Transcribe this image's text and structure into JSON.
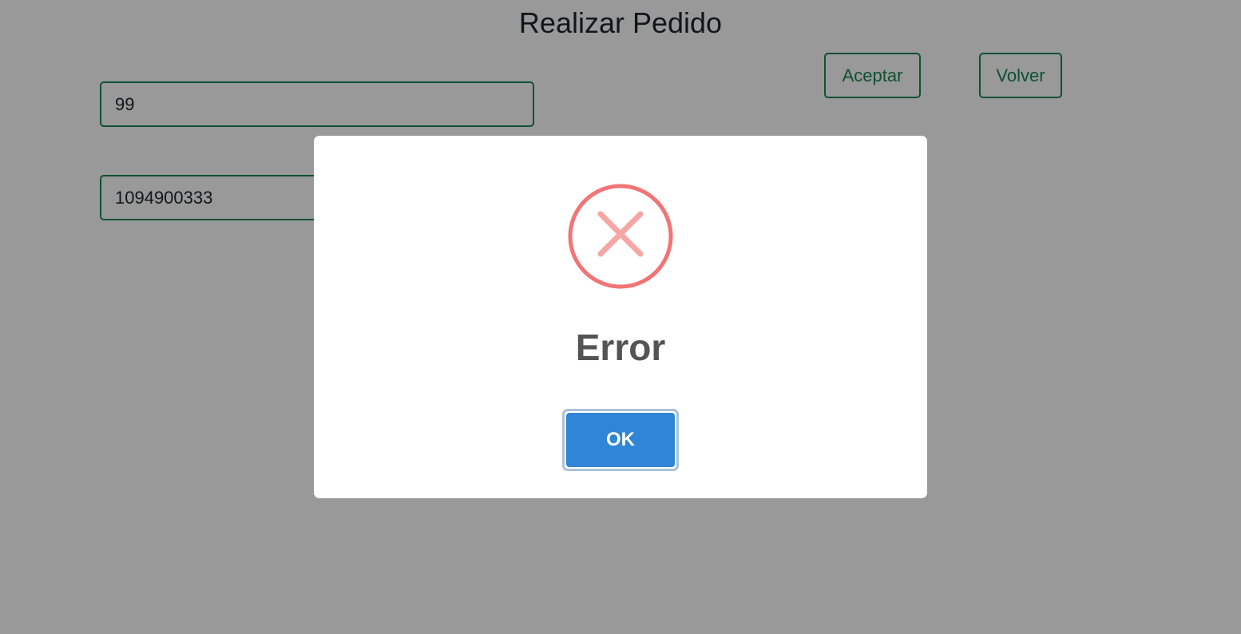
{
  "page": {
    "title": "Realizar Pedido"
  },
  "form": {
    "quantity_value": "99",
    "document_value": "1094900333",
    "accept_label": "Aceptar",
    "back_label": "Volver"
  },
  "dialog": {
    "icon": "error-x-icon",
    "title": "Error",
    "ok_label": "OK"
  },
  "colors": {
    "success_green": "#198754",
    "error_red": "#f27474",
    "confirm_blue": "#3085d6",
    "overlay": "rgba(0,0,0,0.4)"
  }
}
